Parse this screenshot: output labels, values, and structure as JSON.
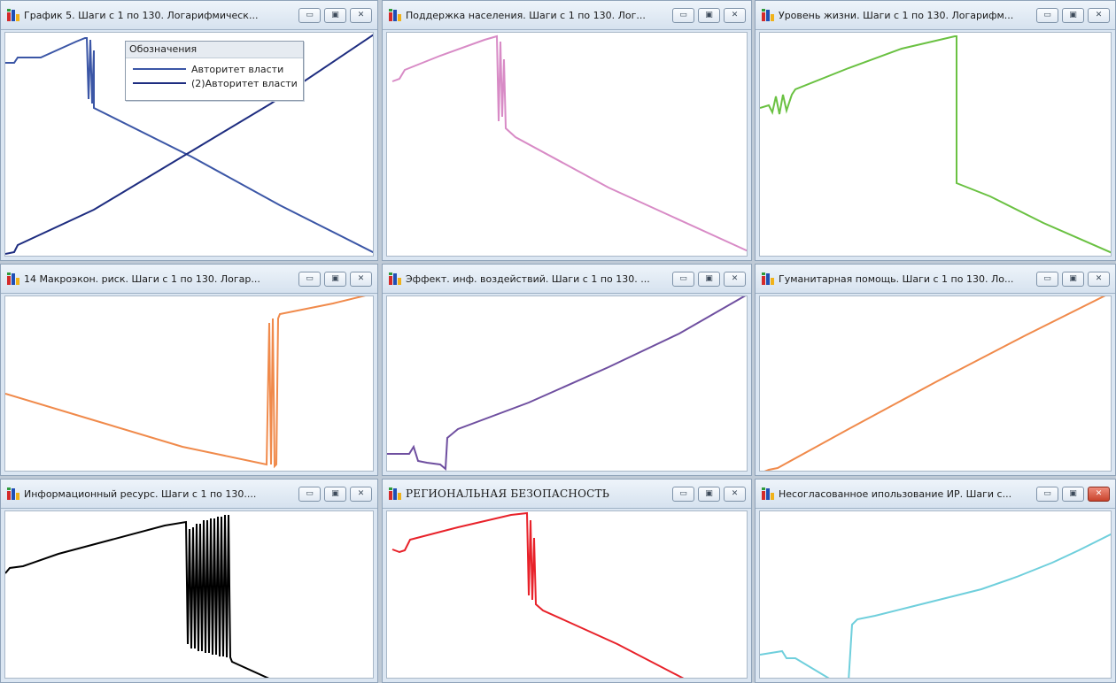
{
  "windows": [
    {
      "id": "w1",
      "title": "График 5. Шаги с 1 по 130. Логарифмическ...",
      "color": "#3b56a6",
      "legend": {
        "title": "Обозначения",
        "items": [
          {
            "label": "Авторитет власти",
            "color": "#3b56a6"
          },
          {
            "label": "(2)Авторитет власти",
            "color": "#1e2d80"
          }
        ]
      }
    },
    {
      "id": "w2",
      "title": "Поддержка населения. Шаги с 1 по 130. Лог...",
      "color": "#d88bc6"
    },
    {
      "id": "w3",
      "title": "Уровень жизни. Шаги с 1 по 130. Логарифм...",
      "color": "#6ac142"
    },
    {
      "id": "w4",
      "title": "14 Макроэкон. риск. Шаги с 1 по 130. Логар...",
      "color": "#f08a4b"
    },
    {
      "id": "w5",
      "title": "Эффект. инф. воздействий. Шаги с 1 по 130. ...",
      "color": "#6f4fa0"
    },
    {
      "id": "w6",
      "title": "Гуманитарная помощь. Шаги с 1 по 130. Ло...",
      "color": "#f08a4b"
    },
    {
      "id": "w7",
      "title": "Информационный ресурс. Шаги с 1 по 130....",
      "color": "#000000"
    },
    {
      "id": "w8",
      "title": "РЕГИОНАЛЬНАЯ БЕЗОПАСНОСТЬ",
      "color": "#e8222a"
    },
    {
      "id": "w9",
      "title": "Несогласованное ипользование ИР. Шаги с...",
      "color": "#6fcfdc"
    }
  ],
  "controls": {
    "minimize": "▭",
    "maximize": "▣",
    "close": "✕"
  }
}
